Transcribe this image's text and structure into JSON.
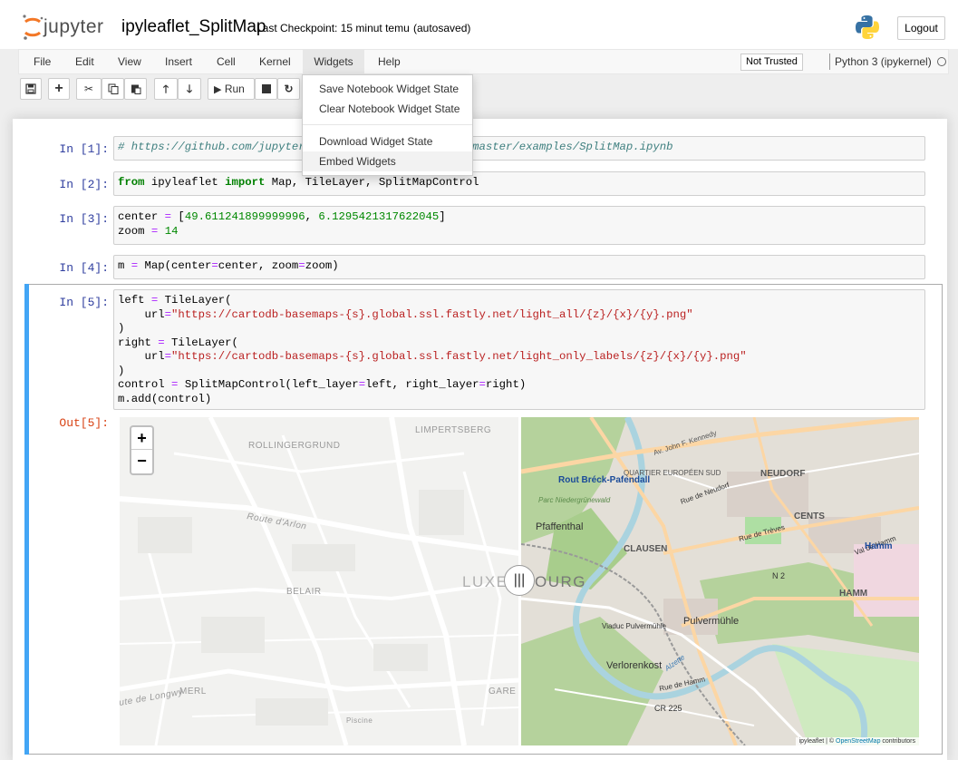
{
  "header": {
    "logo_text": "jupyter",
    "notebook_name": "ipyleaflet_SplitMap",
    "checkpoint": "Last Checkpoint: 15 minut temu",
    "autosave": "(autosaved)",
    "logout": "Logout"
  },
  "menubar": {
    "items": [
      "File",
      "Edit",
      "View",
      "Insert",
      "Cell",
      "Kernel",
      "Widgets",
      "Help"
    ],
    "trusted": "Not Trusted",
    "kernel": "Python 3 (ipykernel)"
  },
  "toolbar": {
    "run_label": "Run"
  },
  "widgets_menu": {
    "items": [
      "Save Notebook Widget State",
      "Clear Notebook Widget State",
      "Download Widget State",
      "Embed Widgets"
    ]
  },
  "cells": [
    {
      "prompt": "In [1]:",
      "code": "# https://github.com/jupyter-widgets/ipyleaflet/blob/master/examples/SplitMap.ipynb"
    },
    {
      "prompt": "In [2]:",
      "code": "from ipyleaflet import Map, TileLayer, SplitMapControl"
    },
    {
      "prompt": "In [3]:",
      "code": "center = [49.611241899999996, 6.1295421317622045]\nzoom = 14"
    },
    {
      "prompt": "In [4]:",
      "code": "m = Map(center=center, zoom=zoom)"
    },
    {
      "prompt": "In [5]:",
      "code": "left = TileLayer(\n    url=\"https://cartodb-basemaps-{s}.global.ssl.fastly.net/light_all/{z}/{x}/{y}.png\"\n)\nright = TileLayer(\n    url=\"https://cartodb-basemaps-{s}.global.ssl.fastly.net/light_only_labels/{z}/{x}/{y}.png\"\n)\ncontrol = SplitMapControl(left_layer=left, right_layer=right)\nm.add(control)"
    }
  ],
  "output": {
    "prompt": "Out[5]:",
    "zoom_in": "+",
    "zoom_out": "−",
    "attribution_prefix": "ipyleaflet | © ",
    "attribution_link": "OpenStreetMap",
    "attribution_suffix": " contributors",
    "left_labels": [
      "LIMPERTSBERG",
      "ROLLINGERGRUND",
      "Route d'Arlon",
      "BELAIR",
      "MERL",
      "GARE",
      "Piscine",
      "ute de Longwy",
      "LUXE"
    ],
    "right_labels": [
      "Rout Bréck-Pafendall",
      "Parc Niedergrünewald",
      "Pfaffenthal",
      "Av. John F. Kennedy",
      "QUARTIER EUROPÉEN SUD",
      "NEUDORF",
      "Rue de Neudorf",
      "CENTS",
      "Rue de Trèves",
      "Val de Hamm",
      "Hamm",
      "CLAUSEN",
      "N 2",
      "HAMM",
      "OURG",
      "Pulvermühle",
      "Viaduc Pulvermühle",
      "Verlorenkost",
      "Rue de Hamm",
      "Alzette",
      "CR 225"
    ]
  },
  "colors": {
    "accent": "#42a5f5",
    "prompt_in": "#303f9f",
    "prompt_out": "#d84315",
    "jupyter_orange": "#f37726"
  }
}
